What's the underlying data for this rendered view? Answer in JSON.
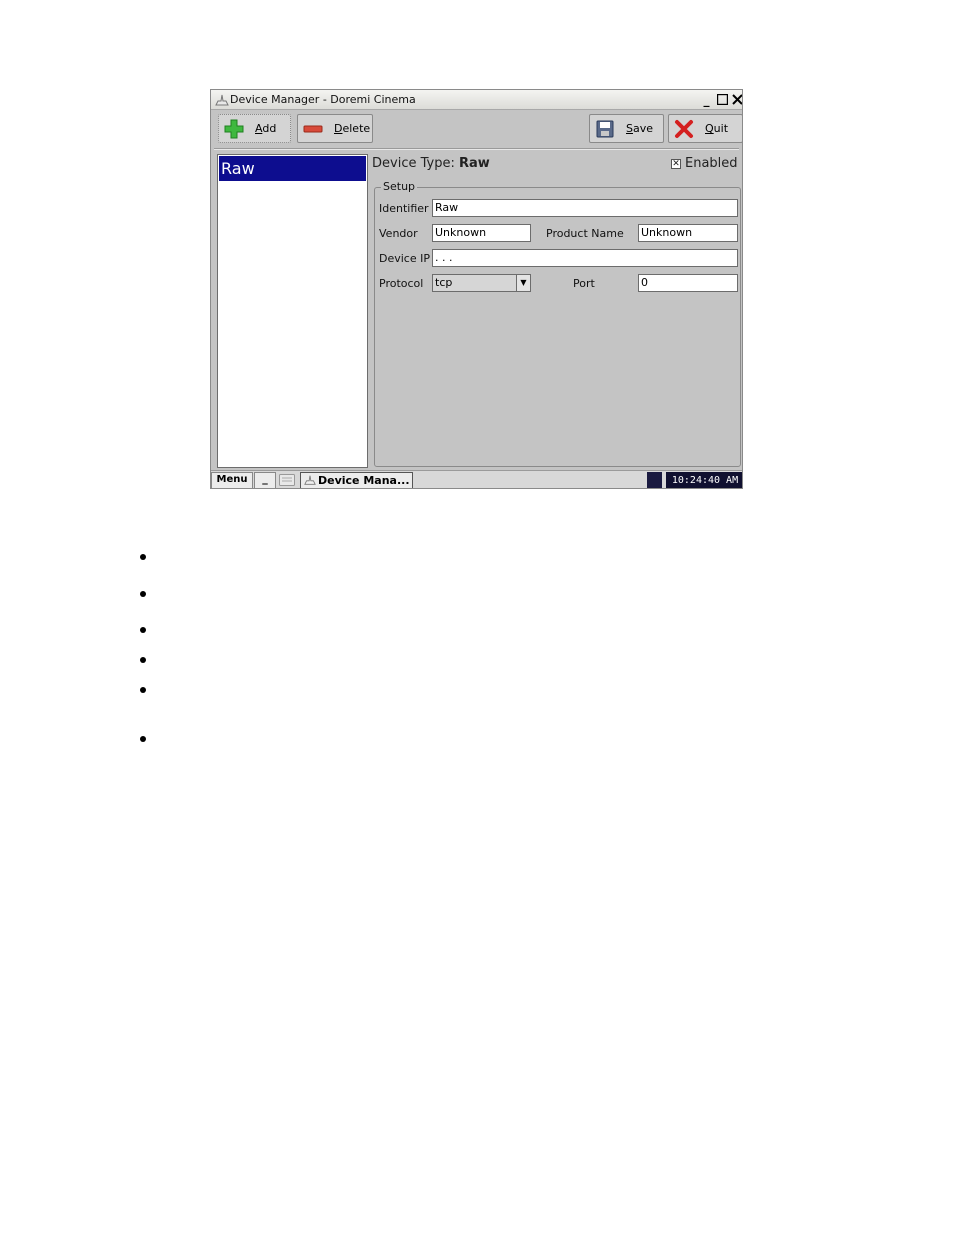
{
  "window": {
    "title": "Device Manager - Doremi Cinema",
    "controls": {
      "minimize": "_",
      "maximize": "□",
      "close": "✕"
    }
  },
  "toolbar": {
    "add_label": "Add",
    "delete_label": "Delete",
    "save_label": "Save",
    "quit_label": "Quit"
  },
  "device_list": {
    "items": [
      {
        "label": "Raw",
        "selected": true
      }
    ]
  },
  "details": {
    "device_type_prefix": "Device Type:",
    "device_type_value": "Raw",
    "enabled_label": "Enabled",
    "enabled_mark": "✕",
    "setup_legend": "Setup",
    "identifier_label": "Identifier",
    "identifier_value": "Raw",
    "vendor_label": "Vendor",
    "vendor_value": "Unknown",
    "product_name_label": "Product Name",
    "product_name_value": "Unknown",
    "device_ip_label": "Device IP",
    "device_ip_value": " .   .   .",
    "protocol_label": "Protocol",
    "protocol_value": "tcp",
    "port_label": "Port",
    "port_value": "0"
  },
  "taskbar": {
    "menu_label": "Menu",
    "minimize_all_label": "_",
    "task_label": "Device Mana...",
    "clock": "10:24:40 AM"
  },
  "colors": {
    "selection": "#0d0d8f",
    "window_bg": "#c4c4c4",
    "clock_bg": "#101030",
    "add_icon": "#3fb83f",
    "delete_icon": "#d84a3a",
    "quit_icon": "#d42020"
  },
  "icons": {
    "add": "plus-icon",
    "delete": "minus-icon",
    "save": "floppy-disk-icon",
    "quit": "x-icon"
  }
}
